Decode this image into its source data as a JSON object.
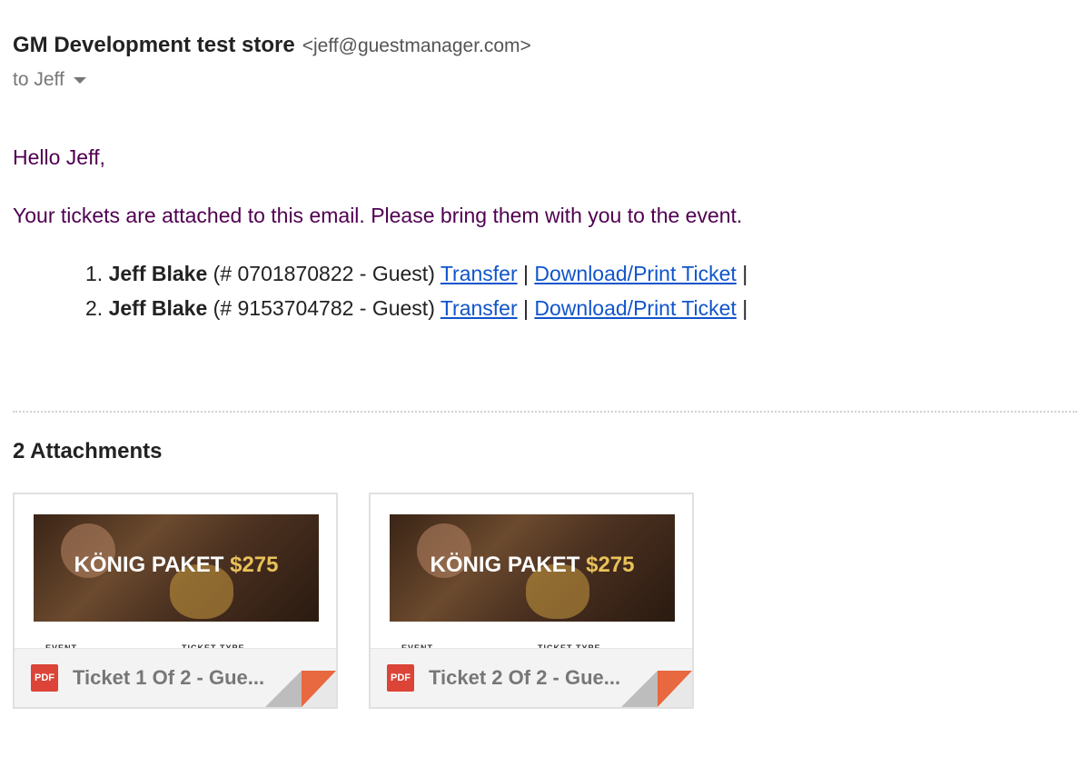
{
  "email": {
    "sender_name": "GM Development test store",
    "sender_email": "<jeff@guestmanager.com>",
    "to_text": "to Jeff"
  },
  "body": {
    "greeting": "Hello Jeff,",
    "intro": "Your tickets are attached to this email. Please bring them with you to the event."
  },
  "tickets": [
    {
      "number": "1.",
      "name": "Jeff Blake",
      "detail": " (# 0701870822 - Guest) ",
      "transfer_label": "Transfer",
      "download_label": "Download/Print Ticket"
    },
    {
      "number": "2.",
      "name": "Jeff Blake",
      "detail": " (# 9153704782 - Guest) ",
      "transfer_label": "Transfer",
      "download_label": "Download/Print Ticket"
    }
  ],
  "separator": "|",
  "attachments": {
    "title": "2 Attachments",
    "items": [
      {
        "name": "Ticket 1 Of 2 - Gue...",
        "file_type": "PDF",
        "thumb_title": "KÖNIG PAKET",
        "thumb_price": "$275",
        "doc_label_left": "EVENT",
        "doc_label_right": "TICKET TYPE"
      },
      {
        "name": "Ticket 2 Of 2 - Gue...",
        "file_type": "PDF",
        "thumb_title": "KÖNIG PAKET",
        "thumb_price": "$275",
        "doc_label_left": "EVENT",
        "doc_label_right": "TICKET TYPE"
      }
    ]
  },
  "colors": {
    "body_text": "#500050",
    "link": "#1155cc",
    "pdf_red": "#db4437",
    "price_gold": "#e8c25a"
  },
  "icons": {
    "recipient_dropdown": "caret-down-icon",
    "file_badge": "pdf-icon"
  }
}
